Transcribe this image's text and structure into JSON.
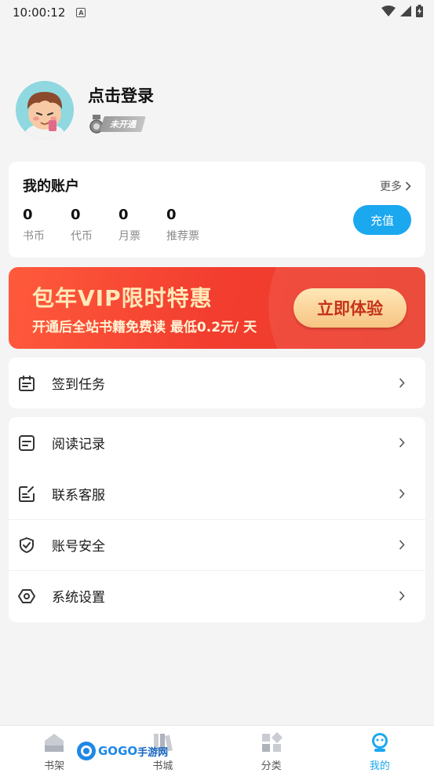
{
  "status_bar": {
    "time": "10:00:12",
    "badge": "A"
  },
  "profile": {
    "login_label": "点击登录",
    "vip_status": "未开通"
  },
  "account": {
    "title": "我的账户",
    "more_label": "更多",
    "stats": [
      {
        "value": "0",
        "label": "书币"
      },
      {
        "value": "0",
        "label": "代币"
      },
      {
        "value": "0",
        "label": "月票"
      },
      {
        "value": "0",
        "label": "推荐票"
      }
    ],
    "recharge_label": "充值"
  },
  "banner": {
    "title": "包年VIP限时特惠",
    "subtitle": "开通后全站书籍免费读 最低0.2元/ 天",
    "button_label": "立即体验"
  },
  "menu_group_1": [
    {
      "label": "签到任务",
      "icon": "calendar-icon"
    }
  ],
  "menu_group_2": [
    {
      "label": "阅读记录",
      "icon": "reading-record-icon"
    },
    {
      "label": "联系客服",
      "icon": "edit-note-icon"
    },
    {
      "label": "账号安全",
      "icon": "shield-check-icon"
    },
    {
      "label": "系统设置",
      "icon": "hex-settings-icon"
    }
  ],
  "bottom_nav": [
    {
      "label": "书架",
      "icon": "bookshelf-icon",
      "active": false
    },
    {
      "label": "书城",
      "icon": "bookstore-icon",
      "active": false
    },
    {
      "label": "分类",
      "icon": "category-icon",
      "active": false
    },
    {
      "label": "我的",
      "icon": "profile-icon",
      "active": true
    }
  ],
  "watermark": {
    "text_logo": "GOGO",
    "text_cn": "手游网",
    "url": "www.gogo86.com"
  },
  "colors": {
    "accent": "#1ba8ef",
    "banner": "#f23d2f",
    "background": "#f4f4f5"
  }
}
